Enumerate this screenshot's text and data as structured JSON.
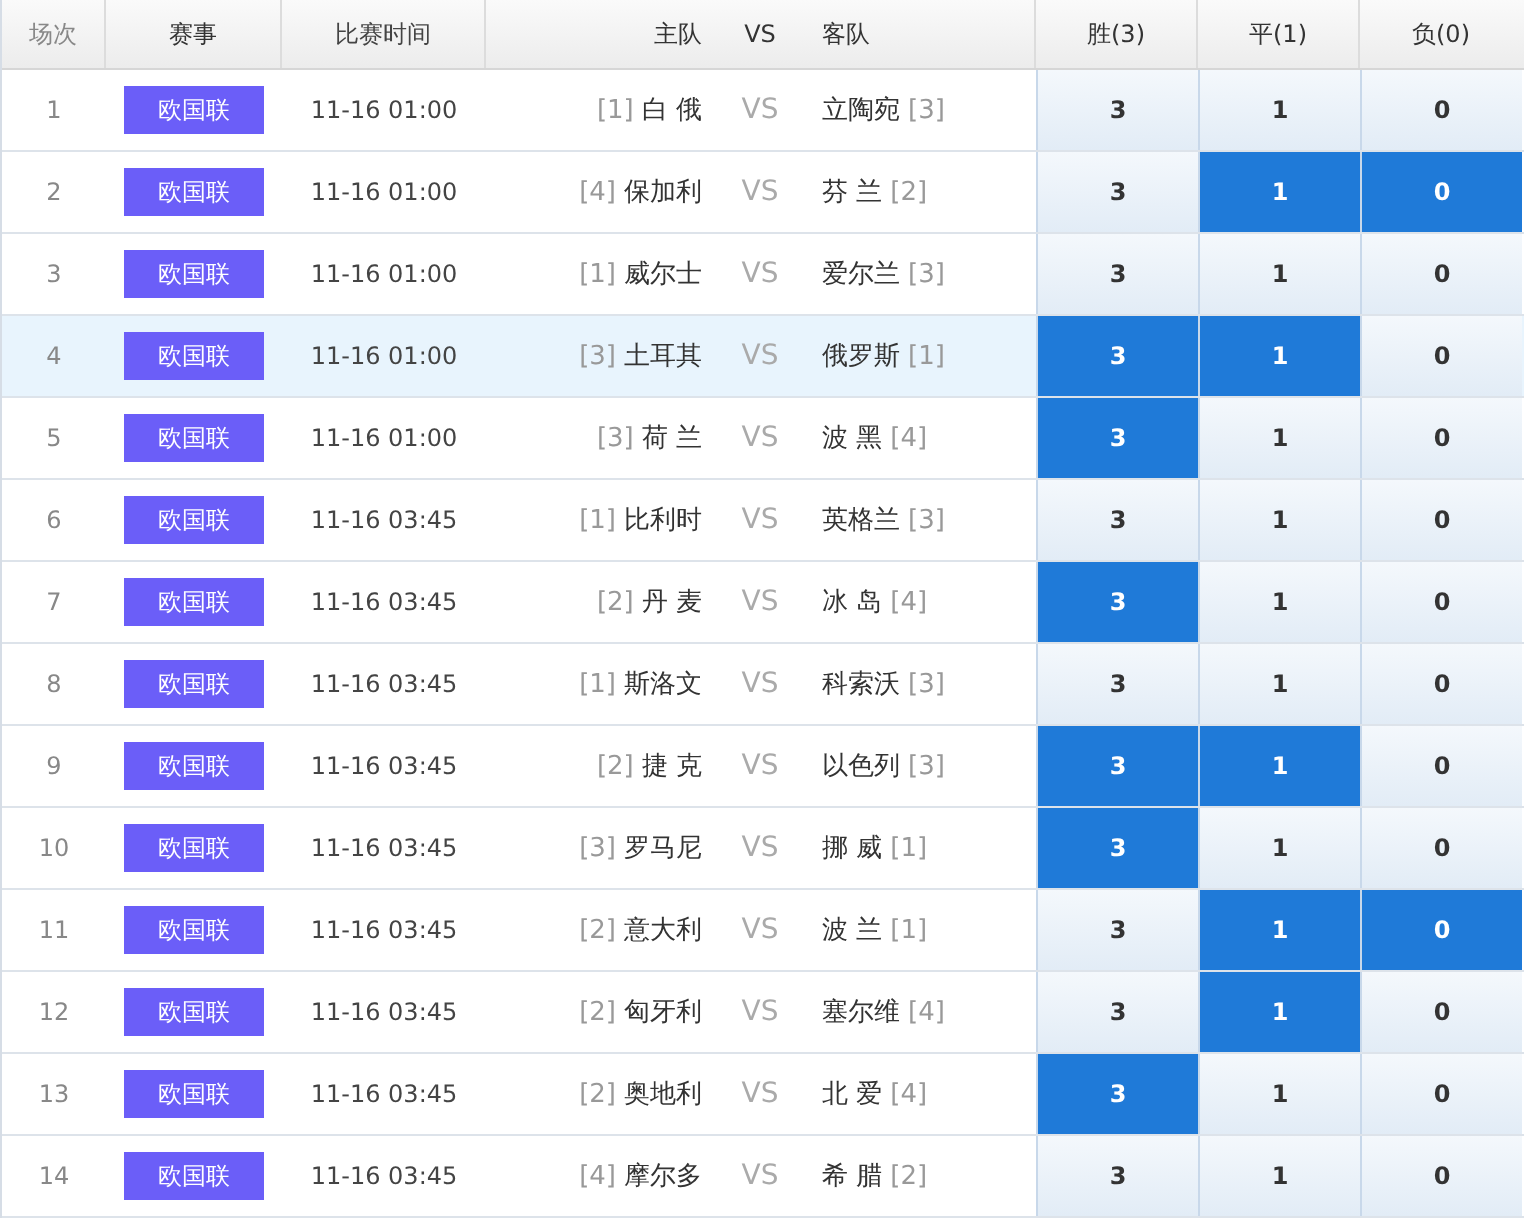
{
  "columns": [
    "场次",
    "赛事",
    "比赛时间",
    "主队",
    "VS",
    "客队",
    "胜(3)",
    "平(1)",
    "负(0)"
  ],
  "rows": [
    {
      "no": "1",
      "league": "欧国联",
      "time": "11-16 01:00",
      "home_rank": "[1]",
      "home": "白 俄",
      "vs": "VS",
      "away": "立陶宛",
      "away_rank": "[3]",
      "highlighted": false,
      "odds": [
        {
          "label": "3",
          "selected": false
        },
        {
          "label": "1",
          "selected": false
        },
        {
          "label": "0",
          "selected": false
        }
      ]
    },
    {
      "no": "2",
      "league": "欧国联",
      "time": "11-16 01:00",
      "home_rank": "[4]",
      "home": "保加利",
      "vs": "VS",
      "away": "芬 兰",
      "away_rank": "[2]",
      "highlighted": false,
      "odds": [
        {
          "label": "3",
          "selected": false
        },
        {
          "label": "1",
          "selected": true
        },
        {
          "label": "0",
          "selected": true
        }
      ]
    },
    {
      "no": "3",
      "league": "欧国联",
      "time": "11-16 01:00",
      "home_rank": "[1]",
      "home": "威尔士",
      "vs": "VS",
      "away": "爱尔兰",
      "away_rank": "[3]",
      "highlighted": false,
      "odds": [
        {
          "label": "3",
          "selected": false
        },
        {
          "label": "1",
          "selected": false
        },
        {
          "label": "0",
          "selected": false
        }
      ]
    },
    {
      "no": "4",
      "league": "欧国联",
      "time": "11-16 01:00",
      "home_rank": "[3]",
      "home": "土耳其",
      "vs": "VS",
      "away": "俄罗斯",
      "away_rank": "[1]",
      "highlighted": true,
      "odds": [
        {
          "label": "3",
          "selected": true
        },
        {
          "label": "1",
          "selected": true
        },
        {
          "label": "0",
          "selected": false
        }
      ]
    },
    {
      "no": "5",
      "league": "欧国联",
      "time": "11-16 01:00",
      "home_rank": "[3]",
      "home": "荷 兰",
      "vs": "VS",
      "away": "波 黑",
      "away_rank": "[4]",
      "highlighted": false,
      "odds": [
        {
          "label": "3",
          "selected": true
        },
        {
          "label": "1",
          "selected": false
        },
        {
          "label": "0",
          "selected": false
        }
      ]
    },
    {
      "no": "6",
      "league": "欧国联",
      "time": "11-16 03:45",
      "home_rank": "[1]",
      "home": "比利时",
      "vs": "VS",
      "away": "英格兰",
      "away_rank": "[3]",
      "highlighted": false,
      "odds": [
        {
          "label": "3",
          "selected": false
        },
        {
          "label": "1",
          "selected": false
        },
        {
          "label": "0",
          "selected": false
        }
      ]
    },
    {
      "no": "7",
      "league": "欧国联",
      "time": "11-16 03:45",
      "home_rank": "[2]",
      "home": "丹 麦",
      "vs": "VS",
      "away": "冰 岛",
      "away_rank": "[4]",
      "highlighted": false,
      "odds": [
        {
          "label": "3",
          "selected": true
        },
        {
          "label": "1",
          "selected": false
        },
        {
          "label": "0",
          "selected": false
        }
      ]
    },
    {
      "no": "8",
      "league": "欧国联",
      "time": "11-16 03:45",
      "home_rank": "[1]",
      "home": "斯洛文",
      "vs": "VS",
      "away": "科索沃",
      "away_rank": "[3]",
      "highlighted": false,
      "odds": [
        {
          "label": "3",
          "selected": false
        },
        {
          "label": "1",
          "selected": false
        },
        {
          "label": "0",
          "selected": false
        }
      ]
    },
    {
      "no": "9",
      "league": "欧国联",
      "time": "11-16 03:45",
      "home_rank": "[2]",
      "home": "捷 克",
      "vs": "VS",
      "away": "以色列",
      "away_rank": "[3]",
      "highlighted": false,
      "odds": [
        {
          "label": "3",
          "selected": true
        },
        {
          "label": "1",
          "selected": true
        },
        {
          "label": "0",
          "selected": false
        }
      ]
    },
    {
      "no": "10",
      "league": "欧国联",
      "time": "11-16 03:45",
      "home_rank": "[3]",
      "home": "罗马尼",
      "vs": "VS",
      "away": "挪 威",
      "away_rank": "[1]",
      "highlighted": false,
      "odds": [
        {
          "label": "3",
          "selected": true
        },
        {
          "label": "1",
          "selected": false
        },
        {
          "label": "0",
          "selected": false
        }
      ]
    },
    {
      "no": "11",
      "league": "欧国联",
      "time": "11-16 03:45",
      "home_rank": "[2]",
      "home": "意大利",
      "vs": "VS",
      "away": "波 兰",
      "away_rank": "[1]",
      "highlighted": false,
      "odds": [
        {
          "label": "3",
          "selected": false
        },
        {
          "label": "1",
          "selected": true
        },
        {
          "label": "0",
          "selected": true
        }
      ]
    },
    {
      "no": "12",
      "league": "欧国联",
      "time": "11-16 03:45",
      "home_rank": "[2]",
      "home": "匈牙利",
      "vs": "VS",
      "away": "塞尔维",
      "away_rank": "[4]",
      "highlighted": false,
      "odds": [
        {
          "label": "3",
          "selected": false
        },
        {
          "label": "1",
          "selected": true
        },
        {
          "label": "0",
          "selected": false
        }
      ]
    },
    {
      "no": "13",
      "league": "欧国联",
      "time": "11-16 03:45",
      "home_rank": "[2]",
      "home": "奥地利",
      "vs": "VS",
      "away": "北 爱",
      "away_rank": "[4]",
      "highlighted": false,
      "odds": [
        {
          "label": "3",
          "selected": true
        },
        {
          "label": "1",
          "selected": false
        },
        {
          "label": "0",
          "selected": false
        }
      ]
    },
    {
      "no": "14",
      "league": "欧国联",
      "time": "11-16 03:45",
      "home_rank": "[4]",
      "home": "摩尔多",
      "vs": "VS",
      "away": "希 腊",
      "away_rank": "[2]",
      "highlighted": false,
      "odds": [
        {
          "label": "3",
          "selected": false
        },
        {
          "label": "1",
          "selected": false
        },
        {
          "label": "0",
          "selected": false
        }
      ]
    }
  ]
}
